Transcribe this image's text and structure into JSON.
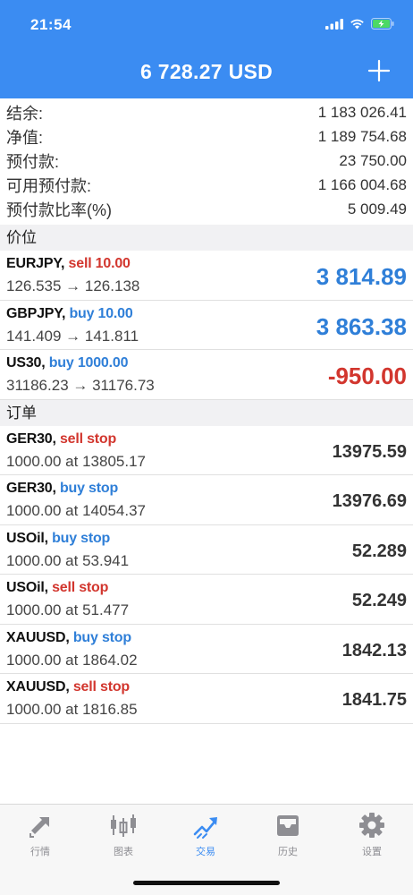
{
  "status": {
    "time": "21:54"
  },
  "header": {
    "balance_title": "6 728.27 USD",
    "accent": "#3b8cf2"
  },
  "summary": [
    {
      "label": "结余:",
      "value": "1 183 026.41"
    },
    {
      "label": "净值:",
      "value": "1 189 754.68"
    },
    {
      "label": "预付款:",
      "value": "23 750.00"
    },
    {
      "label": "可用预付款:",
      "value": "1 166 004.68"
    },
    {
      "label": "预付款比率(%)",
      "value": "5 009.49"
    }
  ],
  "positions": {
    "section_title": "价位",
    "items": [
      {
        "symbol": "EURJPY,",
        "action": "sell 10.00",
        "side": "sell",
        "prices": "126.535 → 126.138",
        "profit": "3 814.89"
      },
      {
        "symbol": "GBPJPY,",
        "action": "buy 10.00",
        "side": "buy",
        "prices": "141.409 → 141.811",
        "profit": "3 863.38"
      },
      {
        "symbol": "US30,",
        "action": "buy 1000.00",
        "side": "buy",
        "prices": "31186.23 → 31176.73",
        "profit": "-950.00"
      }
    ]
  },
  "orders": {
    "section_title": "订单",
    "items": [
      {
        "symbol": "GER30,",
        "action": "sell stop",
        "side": "sell",
        "detail": "1000.00 at 13805.17",
        "price": "13975.59"
      },
      {
        "symbol": "GER30,",
        "action": "buy stop",
        "side": "buy",
        "detail": "1000.00 at 14054.37",
        "price": "13976.69"
      },
      {
        "symbol": "USOil,",
        "action": "buy stop",
        "side": "buy",
        "detail": "1000.00 at 53.941",
        "price": "52.289"
      },
      {
        "symbol": "USOil,",
        "action": "sell stop",
        "side": "sell",
        "detail": "1000.00 at 51.477",
        "price": "52.249"
      },
      {
        "symbol": "XAUUSD,",
        "action": "buy stop",
        "side": "buy",
        "detail": "1000.00 at 1864.02",
        "price": "1842.13"
      },
      {
        "symbol": "XAUUSD,",
        "action": "sell stop",
        "side": "sell",
        "detail": "1000.00 at 1816.85",
        "price": "1841.75"
      }
    ]
  },
  "tabbar": {
    "tabs": [
      {
        "label": "行情",
        "icon": "quotes-arrows-icon"
      },
      {
        "label": "图表",
        "icon": "candlestick-chart-icon"
      },
      {
        "label": "交易",
        "icon": "trade-trend-icon",
        "active": true
      },
      {
        "label": "历史",
        "icon": "history-inbox-icon"
      },
      {
        "label": "设置",
        "icon": "settings-gear-icon"
      }
    ]
  }
}
